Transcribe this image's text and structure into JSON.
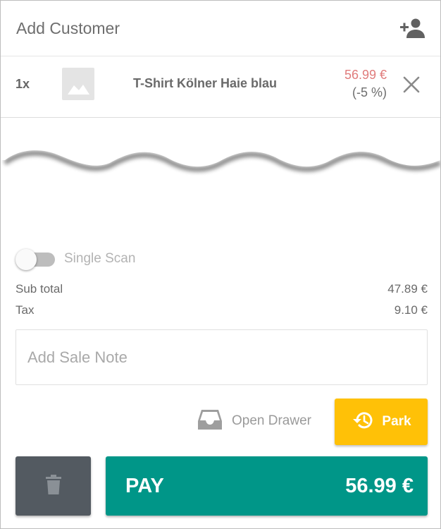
{
  "customer": {
    "title": "Add Customer",
    "icon": "person-add-icon"
  },
  "line_item": {
    "quantity": "1x",
    "image_icon": "image-placeholder-icon",
    "name": "T-Shirt Kölner Haie blau",
    "price": "56.99 €",
    "discount": "(-5 %)",
    "remove_icon": "close-icon"
  },
  "scan": {
    "label": "Single Scan",
    "enabled": false
  },
  "summary": {
    "subtotal_label": "Sub total",
    "subtotal_value": "47.89 €",
    "tax_label": "Tax",
    "tax_value": "9.10 €"
  },
  "note": {
    "placeholder": "Add Sale Note",
    "value": ""
  },
  "actions": {
    "open_drawer_label": "Open Drawer",
    "park_label": "Park",
    "pay_label": "PAY",
    "pay_total": "56.99 €"
  },
  "colors": {
    "pay": "#009688",
    "park": "#ffc107",
    "trash": "#535a61",
    "price": "#e07b7b"
  }
}
